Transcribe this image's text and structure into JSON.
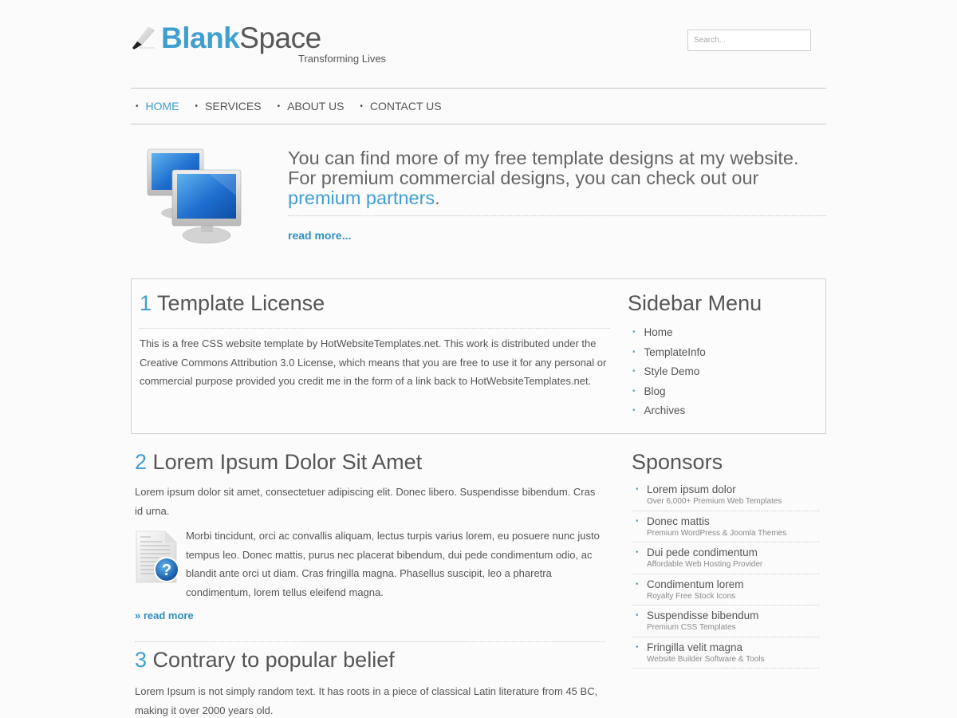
{
  "header": {
    "logo_blank": "Blank",
    "logo_space": "Space",
    "tagline": "Transforming Lives",
    "search_placeholder": "Search..."
  },
  "nav": {
    "items": [
      {
        "label": "HOME",
        "active": true
      },
      {
        "label": "SERVICES",
        "active": false
      },
      {
        "label": "ABOUT US",
        "active": false
      },
      {
        "label": "CONTACT US",
        "active": false
      }
    ]
  },
  "featured": {
    "text_before": "You can find more of my free template designs at my website. For premium commercial designs, you can check out our ",
    "link_text": "premium partners",
    "text_after": ".",
    "read_more": "read more..."
  },
  "license": {
    "num": "1",
    "title": "Template License",
    "body": "This is a free CSS website template by HotWebsiteTemplates.net. This work is distributed under the Creative Commons Attribution 3.0 License, which means that you are free to use it for any personal or commercial purpose provided you credit me in the form of a link back to HotWebsiteTemplates.net."
  },
  "sidebar_menu": {
    "title": "Sidebar Menu",
    "items": [
      "Home",
      "TemplateInfo",
      "Style Demo",
      "Blog",
      "Archives"
    ]
  },
  "post2": {
    "num": "2",
    "title": "Lorem Ipsum Dolor Sit Amet",
    "p1": "Lorem ipsum dolor sit amet, consectetuer adipiscing elit. Donec libero. Suspendisse bibendum. Cras id urna.",
    "p2": "Morbi tincidunt, orci ac convallis aliquam, lectus turpis varius lorem, eu posuere nunc justo tempus leo. Donec mattis, purus nec placerat bibendum, dui pede condimentum odio, ac blandit ante orci ut diam. Cras fringilla magna. Phasellus suscipit, leo a pharetra condimentum, lorem tellus eleifend magna.",
    "read_more": "» read more"
  },
  "post3": {
    "num": "3",
    "title": "Contrary to popular belief",
    "p1": "Lorem Ipsum is not simply random text. It has roots in a piece of classical Latin literature from 45 BC, making it over 2000 years old."
  },
  "sponsors": {
    "title": "Sponsors",
    "items": [
      {
        "name": "Lorem ipsum dolor",
        "desc": "Over 6,000+ Premium Web Templates"
      },
      {
        "name": "Donec mattis",
        "desc": "Premium WordPress & Joomla Themes"
      },
      {
        "name": "Dui pede condimentum",
        "desc": "Affordable Web Hosting Provider"
      },
      {
        "name": "Condimentum lorem",
        "desc": "Royalty Free Stock Icons"
      },
      {
        "name": "Suspendisse bibendum",
        "desc": "Premium CSS Templates"
      },
      {
        "name": "Fringilla velit magna",
        "desc": "Website Builder Software & Tools"
      }
    ]
  },
  "colors": {
    "accent": "#3f9fcf",
    "text": "#555555",
    "link_bold": "#2f8fbf"
  }
}
